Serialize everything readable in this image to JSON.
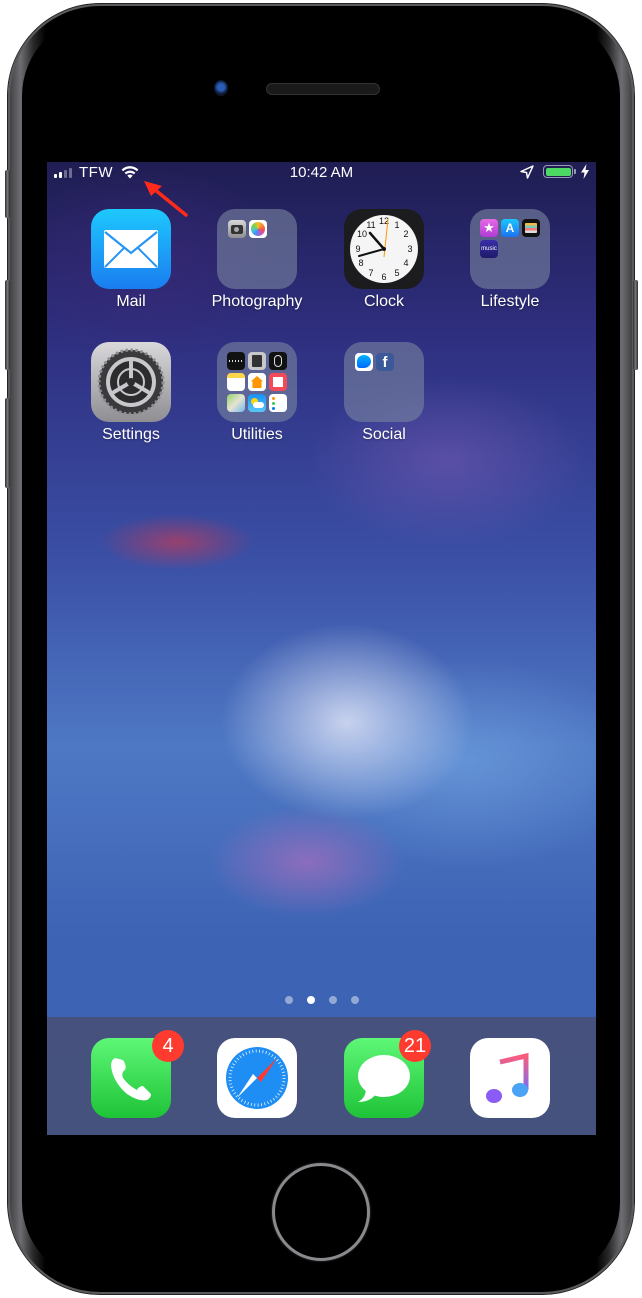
{
  "status_bar": {
    "carrier": "TFW",
    "signal_bars_active": 2,
    "signal_bars_total": 4,
    "time": "10:42 AM",
    "battery_level": 1.0,
    "battery_charging": true,
    "location_services": true,
    "wifi_connected": true
  },
  "annotation": {
    "type": "red-arrow",
    "target": "wifi-icon",
    "color": "#ff2a1a"
  },
  "home_screen": {
    "apps": [
      {
        "label": "Mail",
        "type": "app",
        "icon": "mail-icon"
      },
      {
        "label": "Photography",
        "type": "folder",
        "contents": [
          "camera-icon",
          "photos-icon"
        ]
      },
      {
        "label": "Clock",
        "type": "app",
        "icon": "clock-icon"
      },
      {
        "label": "Lifestyle",
        "type": "folder",
        "contents": [
          "itunes-store-icon",
          "app-store-icon",
          "wallet-icon",
          "amazon-music-icon"
        ]
      },
      {
        "label": "Settings",
        "type": "app",
        "icon": "settings-gear-icon"
      },
      {
        "label": "Utilities",
        "type": "folder",
        "contents": [
          "voice-memos-icon",
          "calculator-icon",
          "watch-icon",
          "notes-icon",
          "home-icon",
          "news-icon",
          "maps-icon",
          "weather-icon",
          "reminders-icon"
        ]
      },
      {
        "label": "Social",
        "type": "folder",
        "contents": [
          "messenger-icon",
          "facebook-icon"
        ]
      }
    ],
    "page_indicator": {
      "total": 4,
      "active_index": 1
    }
  },
  "dock": {
    "apps": [
      {
        "name": "Phone",
        "icon": "phone-icon",
        "badge": "4"
      },
      {
        "name": "Safari",
        "icon": "safari-compass-icon",
        "badge": null
      },
      {
        "name": "Messages",
        "icon": "messages-bubble-icon",
        "badge": "21"
      },
      {
        "name": "Music",
        "icon": "music-note-icon",
        "badge": null
      }
    ]
  },
  "colors": {
    "battery_green": "#4cd964",
    "badge_red": "#ff3b30",
    "mail_blue": "#1e9bf5",
    "phone_green": "#34c759"
  }
}
